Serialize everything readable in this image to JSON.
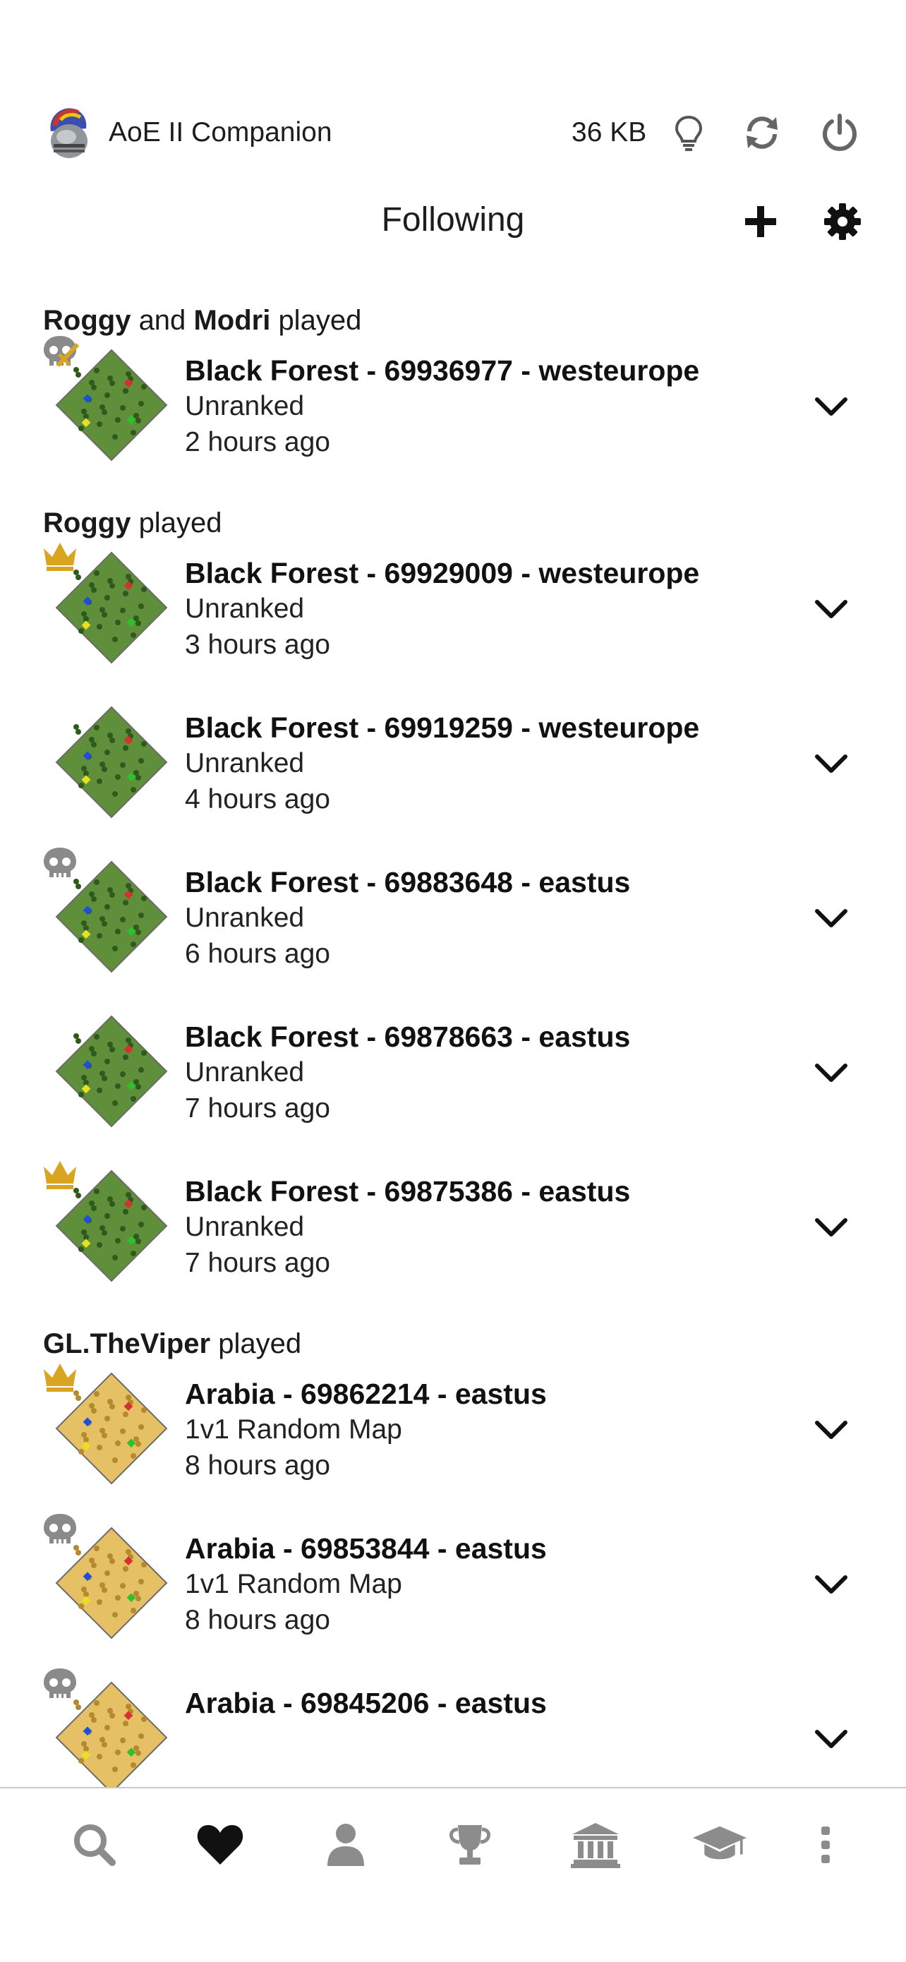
{
  "header": {
    "app_title": "AoE II Companion",
    "cache_size": "36 KB"
  },
  "titlebar": {
    "title": "Following"
  },
  "groups": [
    {
      "players": [
        "Roggy",
        "Modri"
      ],
      "joiner": "and",
      "suffix": "played"
    },
    {
      "players": [
        "Roggy"
      ],
      "joiner": "",
      "suffix": "played"
    },
    {
      "players": [
        "GL.TheViper"
      ],
      "joiner": "",
      "suffix": "played"
    }
  ],
  "matches": [
    {
      "title": "Black Forest - 69936977 - westeurope",
      "type": "Unranked",
      "time": "2 hours ago",
      "badge": "skull-sword",
      "map": "forest"
    },
    {
      "title": "Black Forest - 69929009 - westeurope",
      "type": "Unranked",
      "time": "3 hours ago",
      "badge": "crown",
      "map": "forest"
    },
    {
      "title": "Black Forest - 69919259 - westeurope",
      "type": "Unranked",
      "time": "4 hours ago",
      "badge": "none",
      "map": "forest"
    },
    {
      "title": "Black Forest - 69883648 - eastus",
      "type": "Unranked",
      "time": "6 hours ago",
      "badge": "skull",
      "map": "forest"
    },
    {
      "title": "Black Forest - 69878663 - eastus",
      "type": "Unranked",
      "time": "7 hours ago",
      "badge": "none",
      "map": "forest"
    },
    {
      "title": "Black Forest - 69875386 - eastus",
      "type": "Unranked",
      "time": "7 hours ago",
      "badge": "crown",
      "map": "forest"
    },
    {
      "title": "Arabia - 69862214 - eastus",
      "type": "1v1 Random Map",
      "time": "8 hours ago",
      "badge": "crown",
      "map": "arabia"
    },
    {
      "title": "Arabia - 69853844 - eastus",
      "type": "1v1 Random Map",
      "time": "8 hours ago",
      "badge": "skull",
      "map": "arabia"
    },
    {
      "title": "Arabia - 69845206 - eastus",
      "type": "",
      "time": "",
      "badge": "skull",
      "map": "arabia"
    }
  ],
  "icons": {
    "app": "helmet-icon",
    "cache": "lightbulb-icon",
    "refresh": "refresh-icon",
    "power": "power-icon",
    "add": "plus-icon",
    "settings": "gear-icon",
    "expand": "chevron-down-icon",
    "tabs": [
      "search-icon",
      "heart-icon",
      "person-icon",
      "trophy-icon",
      "bank-icon",
      "graduation-cap-icon",
      "more-vertical-icon"
    ]
  },
  "colors": {
    "crown": "#d9a520",
    "skull": "#8a8a8a",
    "tab_active": "#111111",
    "tab_inactive": "#8c8c8c",
    "forest_map": "#5f8f3a",
    "arabia_map": "#e5c064"
  }
}
